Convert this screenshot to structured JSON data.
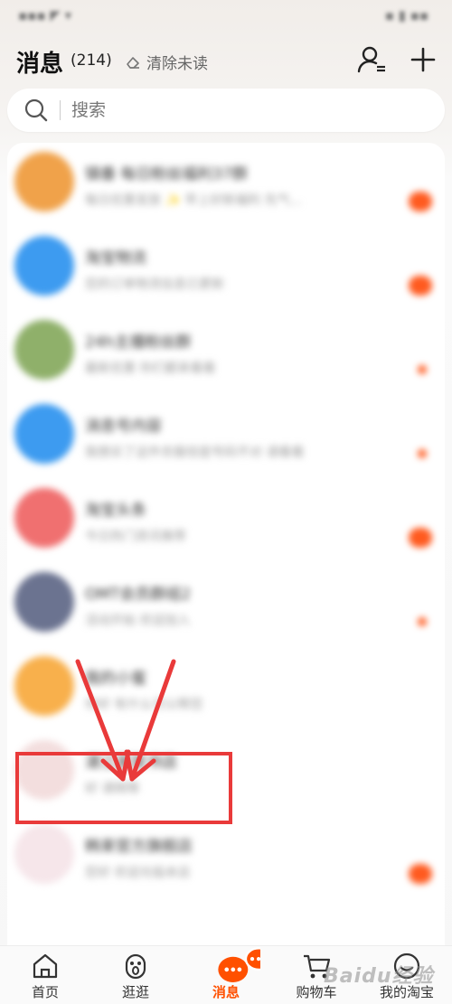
{
  "header": {
    "title": "消息",
    "count": "(214)",
    "clear_unread": "清除未读"
  },
  "search": {
    "placeholder": "搜索"
  },
  "conversations": [
    {
      "title": "镇番 每日粉丝福利37群",
      "subtitle": "每日优惠发放 ✨ 早上好新福利 先气...",
      "avatar_color": "#f0a24a",
      "indicator": "badge"
    },
    {
      "title": "淘宝物流",
      "subtitle": "您的订单物流信息已更新",
      "avatar_color": "#3d9bf0",
      "indicator": "badge"
    },
    {
      "title": "24h主播粉丝群",
      "subtitle": "最新优惠 你们都来看看",
      "avatar_color": "#8fb06a",
      "indicator": "dot"
    },
    {
      "title": "消息号内容",
      "subtitle": "我想买了这件衣服但是号码不对 请看看",
      "avatar_color": "#3d9bf0",
      "indicator": "dot"
    },
    {
      "title": "淘宝头条",
      "subtitle": "今日热门资讯推荐",
      "avatar_color": "#f07070",
      "indicator": "badge"
    },
    {
      "title": "OMT会员群组2",
      "subtitle": "活动开始 欢迎加入",
      "avatar_color": "#6b7390",
      "indicator": "dot"
    },
    {
      "title": "我的小蜜",
      "subtitle": "你好 有什么可以帮您",
      "avatar_color": "#f8b04c",
      "indicator": "none"
    },
    {
      "title": "湛江某某书店",
      "subtitle": "好 请稍等",
      "avatar_color": "#f3dede",
      "indicator": "none"
    },
    {
      "title": "韩束官方旗舰店",
      "subtitle": "您好 欢迎光临本店",
      "avatar_color": "#f6e6ea",
      "indicator": "badge"
    }
  ],
  "tabbar": {
    "items": [
      {
        "label": "首页"
      },
      {
        "label": "逛逛"
      },
      {
        "label": "消息"
      },
      {
        "label": "购物车"
      },
      {
        "label": "我的淘宝"
      }
    ],
    "active_index": 2
  },
  "accent_color": "#ff5000",
  "annotation_color": "#e93a3a",
  "watermark": "Baidu经验"
}
